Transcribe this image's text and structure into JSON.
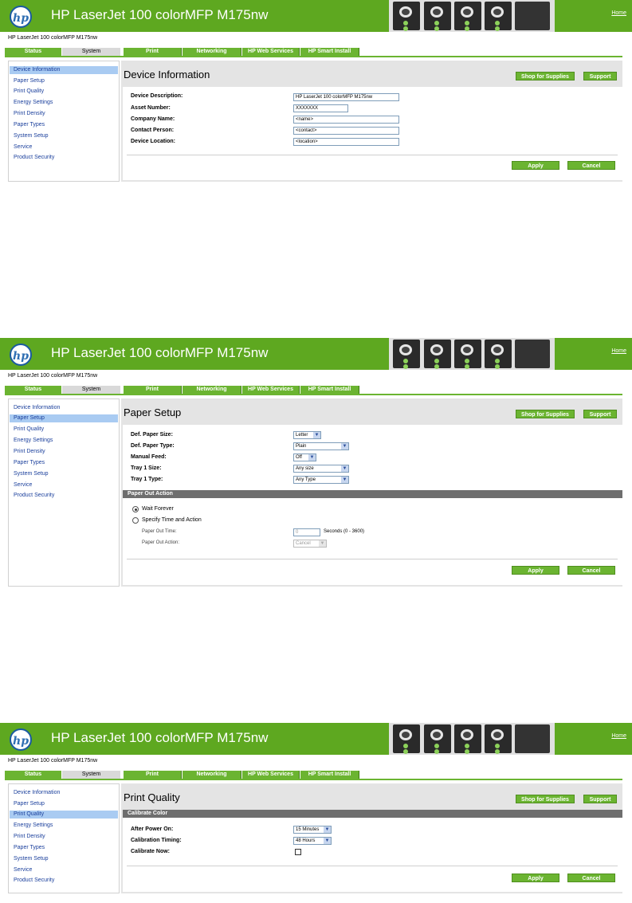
{
  "header": {
    "logo_text": "hp",
    "title": "HP LaserJet 100 colorMFP M175nw",
    "home_link": "Home",
    "brand_color": "#5ea820"
  },
  "subtitle": "HP LaserJet 100 colorMFP M175nw",
  "tabs": {
    "status": "Status",
    "system": "System",
    "print": "Print",
    "networking": "Networking",
    "web_services": "HP Web Services",
    "smart_install": "HP Smart Install"
  },
  "sidebar": {
    "items": [
      {
        "label": "Device Information"
      },
      {
        "label": "Paper Setup"
      },
      {
        "label": "Print Quality"
      },
      {
        "label": "Energy Settings"
      },
      {
        "label": "Print Density"
      },
      {
        "label": "Paper Types"
      },
      {
        "label": "System Setup"
      },
      {
        "label": "Service"
      },
      {
        "label": "Product Security"
      }
    ]
  },
  "buttons": {
    "shop": "Shop for Supplies",
    "support": "Support",
    "apply": "Apply",
    "cancel": "Cancel"
  },
  "panel1": {
    "title": "Device Information",
    "active_item": "Device Information",
    "fields": [
      {
        "label": "Device Description:",
        "value": "HP LaserJet 100 colorMFP M175nw"
      },
      {
        "label": "Asset Number:",
        "value": "XXXXXXX"
      },
      {
        "label": "Company Name:",
        "value": "<name>"
      },
      {
        "label": "Contact Person:",
        "value": "<contact>"
      },
      {
        "label": "Device Location:",
        "value": "<location>"
      }
    ]
  },
  "panel2": {
    "title": "Paper Setup",
    "active_item": "Paper Setup",
    "fields": [
      {
        "label": "Def. Paper Size:",
        "value": "Letter"
      },
      {
        "label": "Def. Paper Type:",
        "value": "Plain"
      },
      {
        "label": "Manual Feed:",
        "value": "Off"
      },
      {
        "label": "Tray 1 Size:",
        "value": "Any size"
      },
      {
        "label": "Tray 1 Type:",
        "value": "Any Type"
      }
    ],
    "section": "Paper Out Action",
    "radio_wait": "Wait Forever",
    "radio_specify": "Specify Time and Action",
    "paper_out_time_label": "Paper Out Time:",
    "paper_out_time_value": "0",
    "seconds_hint": "Seconds (0 - 3600)",
    "paper_out_action_label": "Paper Out Action:",
    "paper_out_action_value": "Cancel"
  },
  "panel3": {
    "title": "Print Quality",
    "active_item": "Print Quality",
    "section": "Calibrate Color",
    "fields": [
      {
        "label": "After Power On:",
        "value": "15 Minutes"
      },
      {
        "label": "Calibration Timing:",
        "value": "48 Hours"
      }
    ],
    "calibrate_now_label": "Calibrate Now:"
  }
}
